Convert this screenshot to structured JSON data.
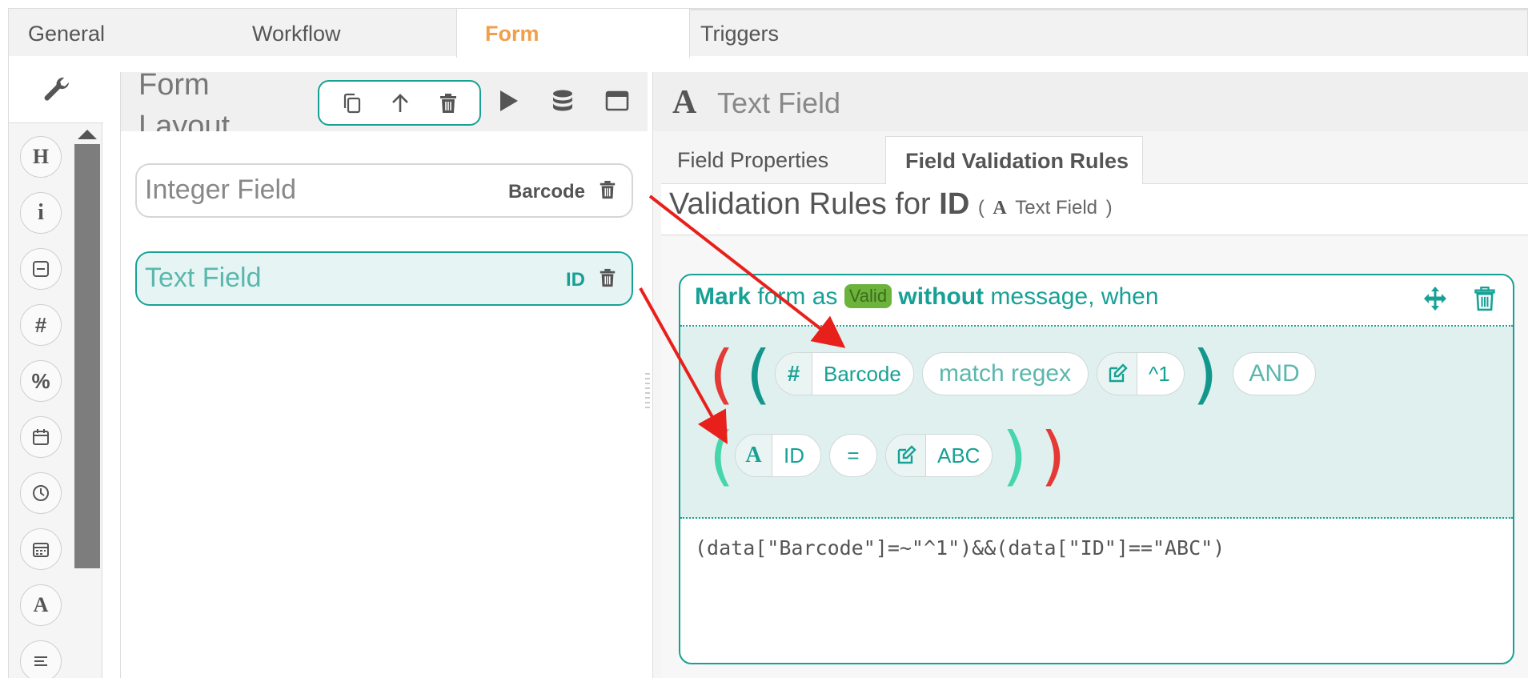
{
  "top_tabs": [
    {
      "label": "General"
    },
    {
      "label": "Workflow"
    },
    {
      "label": "Form",
      "active": true
    },
    {
      "label": "Triggers"
    }
  ],
  "tools": {
    "icons": [
      "wrench-icon",
      "heading-icon",
      "info-icon",
      "section-icon",
      "hash-icon",
      "percent-icon",
      "calendar-icon",
      "clock-icon",
      "datetime-icon",
      "text-icon",
      "paragraph-icon"
    ],
    "letters": {
      "heading": "H",
      "info": "i",
      "hash": "#",
      "percent": "%",
      "text": "A"
    }
  },
  "layout": {
    "title": "Form Layout",
    "fields": [
      {
        "label": "Integer Field",
        "id": "Barcode",
        "selected": false
      },
      {
        "label": "Text Field",
        "id": "ID",
        "selected": true
      }
    ]
  },
  "right": {
    "header_icon": "A",
    "header_title": "Text Field",
    "subtabs": [
      {
        "label": "Field Properties"
      },
      {
        "label": "Field Validation Rules",
        "active": true
      }
    ],
    "validation": {
      "prefix": "Validation Rules for",
      "field": "ID",
      "open_paren": "(",
      "type_icon": "A",
      "type_label": "Text Field",
      "close_paren": ")"
    }
  },
  "rule": {
    "mark": "Mark",
    "form_as": "form as",
    "badge": "Valid",
    "without": "without",
    "message_when": "message, when",
    "row1": {
      "field_icon": "#",
      "field": "Barcode",
      "operator": "match regex",
      "value": "^1",
      "logic": "AND"
    },
    "row2": {
      "field_icon": "A",
      "field": "ID",
      "operator": "=",
      "value": "ABC"
    },
    "expression": "(data[\"Barcode\"]=~\"^1\")&&(data[\"ID\"]==\"ABC\")"
  },
  "colors": {
    "teal": "#17a195",
    "orange": "#f0a04b",
    "red": "#e53935",
    "mint": "#45d6ad",
    "green_badge": "#6bb33b",
    "annotation_arrow": "#e8201c"
  }
}
